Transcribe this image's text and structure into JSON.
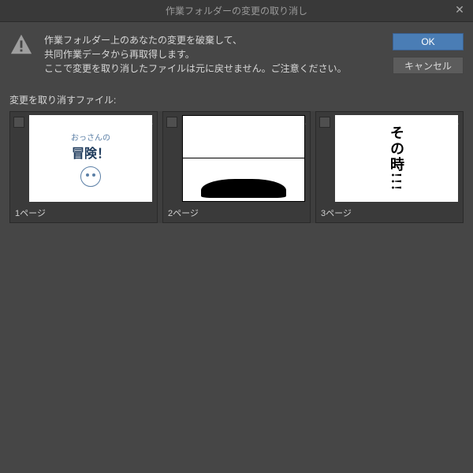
{
  "dialog": {
    "title": "作業フォルダーの変更の取り消し",
    "close_label": "✕"
  },
  "message": {
    "line1": "作業フォルダー上のあなたの変更を破棄して、",
    "line2": "共同作業データから再取得します。",
    "line3": "ここで変更を取り消したファイルは元に戻せません。ご注意ください。"
  },
  "buttons": {
    "ok": "OK",
    "cancel": "キャンセル"
  },
  "section": {
    "label": "変更を取り消すファイル:"
  },
  "files": [
    {
      "label": "1ページ",
      "thumb_text_small": "おっさんの",
      "thumb_text_large": "冒険！"
    },
    {
      "label": "2ページ",
      "panel_text": ""
    },
    {
      "label": "3ページ",
      "thumb_text": "その時!!!"
    }
  ]
}
